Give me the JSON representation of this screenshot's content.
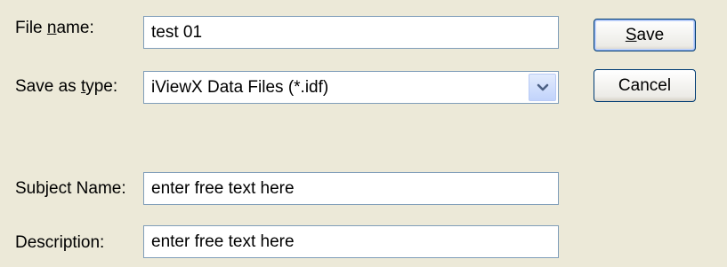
{
  "file_name": {
    "label_before": "File ",
    "label_key": "n",
    "label_after": "ame:",
    "value": "test 01"
  },
  "save_as_type": {
    "label_before": "Save as ",
    "label_key": "t",
    "label_after": "ype:",
    "selected": "iViewX Data Files (*.idf)",
    "dropdown_icon": "chevron-down-icon"
  },
  "subject_name": {
    "label": "Subject Name:",
    "value": "enter free text here"
  },
  "description": {
    "label": "Description:",
    "value": "enter free text here"
  },
  "buttons": {
    "save_key": "S",
    "save_rest": "ave",
    "cancel": "Cancel"
  },
  "colors": {
    "background": "#ece9d8",
    "field_border": "#7f9db9",
    "button_border": "#003c74",
    "dropdown_arrow": "#4d6185"
  }
}
